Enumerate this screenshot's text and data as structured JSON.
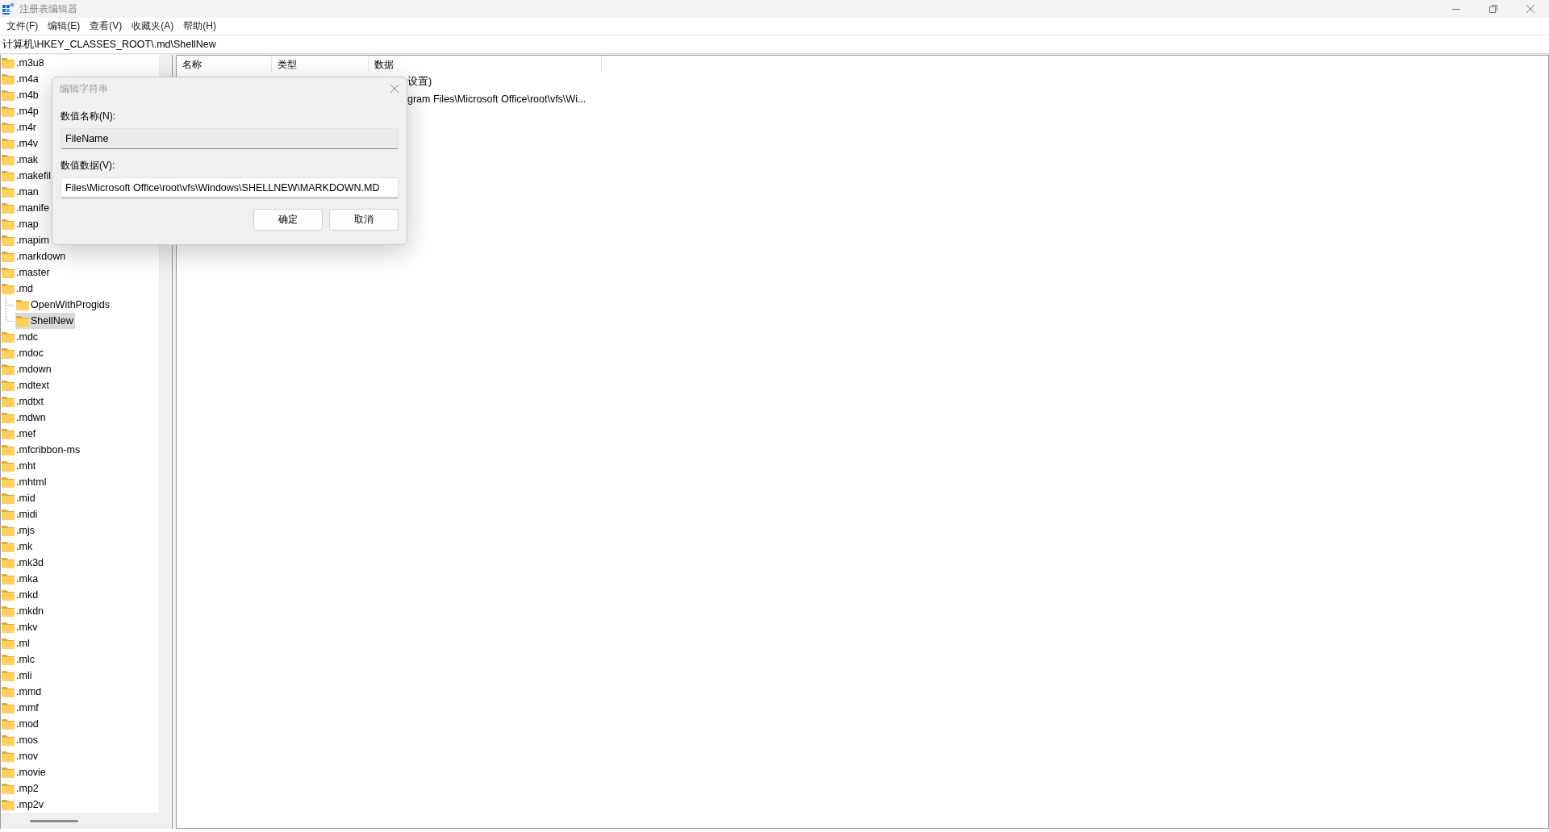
{
  "window": {
    "title": "注册表编辑器"
  },
  "menu": [
    "文件(F)",
    "编辑(E)",
    "查看(V)",
    "收藏夹(A)",
    "帮助(H)"
  ],
  "address": "计算机\\HKEY_CLASSES_ROOT\\.md\\ShellNew",
  "tree": {
    "items": [
      {
        "label": ".m3u8",
        "selected": false
      },
      {
        "label": ".m4a",
        "selected": false
      },
      {
        "label": ".m4b",
        "selected": false
      },
      {
        "label": ".m4p",
        "selected": false
      },
      {
        "label": ".m4r",
        "selected": false
      },
      {
        "label": ".m4v",
        "selected": false
      },
      {
        "label": ".mak",
        "selected": false
      },
      {
        "label": ".makefil",
        "selected": false
      },
      {
        "label": ".man",
        "selected": false
      },
      {
        "label": ".manife",
        "selected": false
      },
      {
        "label": ".map",
        "selected": false
      },
      {
        "label": ".mapim",
        "selected": false
      },
      {
        "label": ".markdown",
        "selected": false
      },
      {
        "label": ".master",
        "selected": false
      },
      {
        "label": ".md",
        "selected": false,
        "children": [
          {
            "label": "OpenWithProgids",
            "selected": false
          },
          {
            "label": "ShellNew",
            "selected": true
          }
        ]
      },
      {
        "label": ".mdc",
        "selected": false
      },
      {
        "label": ".mdoc",
        "selected": false
      },
      {
        "label": ".mdown",
        "selected": false
      },
      {
        "label": ".mdtext",
        "selected": false
      },
      {
        "label": ".mdtxt",
        "selected": false
      },
      {
        "label": ".mdwn",
        "selected": false
      },
      {
        "label": ".mef",
        "selected": false
      },
      {
        "label": ".mfcribbon-ms",
        "selected": false
      },
      {
        "label": ".mht",
        "selected": false
      },
      {
        "label": ".mhtml",
        "selected": false
      },
      {
        "label": ".mid",
        "selected": false
      },
      {
        "label": ".midi",
        "selected": false
      },
      {
        "label": ".mjs",
        "selected": false
      },
      {
        "label": ".mk",
        "selected": false
      },
      {
        "label": ".mk3d",
        "selected": false
      },
      {
        "label": ".mka",
        "selected": false
      },
      {
        "label": ".mkd",
        "selected": false
      },
      {
        "label": ".mkdn",
        "selected": false
      },
      {
        "label": ".mkv",
        "selected": false
      },
      {
        "label": ".ml",
        "selected": false
      },
      {
        "label": ".mlc",
        "selected": false
      },
      {
        "label": ".mli",
        "selected": false
      },
      {
        "label": ".mmd",
        "selected": false
      },
      {
        "label": ".mmf",
        "selected": false
      },
      {
        "label": ".mod",
        "selected": false
      },
      {
        "label": ".mos",
        "selected": false
      },
      {
        "label": ".mov",
        "selected": false
      },
      {
        "label": ".movie",
        "selected": false
      },
      {
        "label": ".mp2",
        "selected": false
      },
      {
        "label": ".mp2v",
        "selected": false
      }
    ]
  },
  "list": {
    "columns": [
      "名称",
      "类型",
      "数据"
    ],
    "rows": [
      {
        "data": "设置)"
      },
      {
        "data": "gram Files\\Microsoft Office\\root\\vfs\\Wi..."
      }
    ]
  },
  "dialog": {
    "title": "编辑字符串",
    "name_label": "数值名称(N):",
    "name_value": "FileName",
    "name_disabled": true,
    "data_label": "数值数据(V):",
    "data_value": "Files\\Microsoft Office\\root\\vfs\\Windows\\SHELLNEW\\MARKDOWN.MD",
    "data_disabled": false,
    "buttons": [
      "确定",
      "取消"
    ]
  }
}
